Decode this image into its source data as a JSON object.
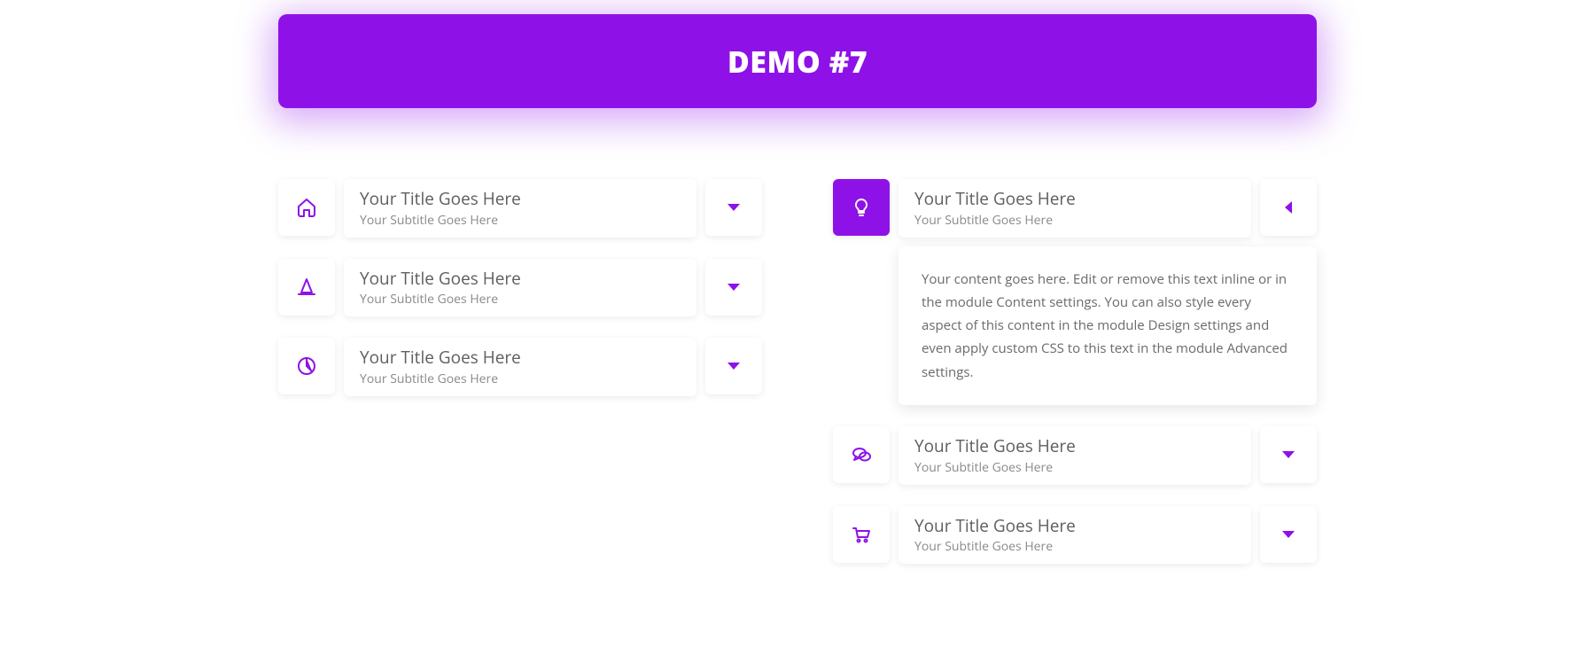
{
  "hero": {
    "title": "DEMO #7"
  },
  "left": {
    "items": [
      {
        "icon": "home",
        "title": "Your Title Goes Here",
        "subtitle": "Your Subtitle Goes Here",
        "expanded": false
      },
      {
        "icon": "cone",
        "title": "Your Title Goes Here",
        "subtitle": "Your Subtitle Goes Here",
        "expanded": false
      },
      {
        "icon": "chart",
        "title": "Your Title Goes Here",
        "subtitle": "Your Subtitle Goes Here",
        "expanded": false
      }
    ]
  },
  "right": {
    "items": [
      {
        "icon": "bulb",
        "title": "Your Title Goes Here",
        "subtitle": "Your Subtitle Goes Here",
        "expanded": true,
        "content": "Your content goes here. Edit or remove this text inline or in the module Content settings. You can also style every aspect of this content in the module Design settings and even apply custom CSS to this text in the module Advanced settings."
      },
      {
        "icon": "chat",
        "title": "Your Title Goes Here",
        "subtitle": "Your Subtitle Goes Here",
        "expanded": false
      },
      {
        "icon": "cart",
        "title": "Your Title Goes Here",
        "subtitle": "Your Subtitle Goes Here",
        "expanded": false
      }
    ]
  }
}
